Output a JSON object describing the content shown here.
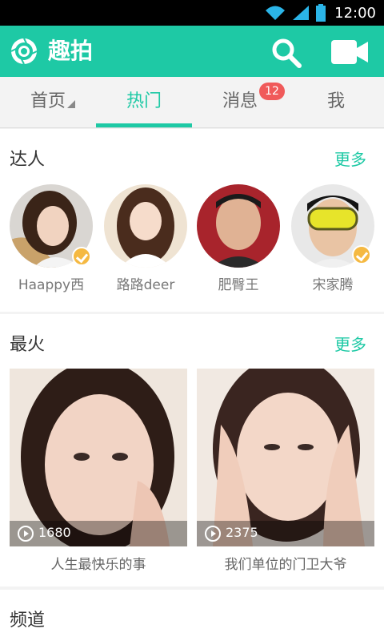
{
  "status": {
    "time": "12:00"
  },
  "header": {
    "title": "趣拍"
  },
  "tabs": [
    {
      "label": "首页"
    },
    {
      "label": "热门",
      "active": true
    },
    {
      "label": "消息",
      "badge": "12"
    },
    {
      "label": "我"
    }
  ],
  "experts": {
    "title": "达人",
    "more": "更多",
    "users": [
      {
        "name": "Haappy西",
        "verified": true
      },
      {
        "name": "路路deer",
        "verified": false
      },
      {
        "name": "肥臀王",
        "verified": false
      },
      {
        "name": "宋家腾",
        "verified": true
      }
    ]
  },
  "hottest": {
    "title": "最火",
    "more": "更多",
    "videos": [
      {
        "plays": "1680",
        "caption": "人生最快乐的事"
      },
      {
        "plays": "2375",
        "caption": "我们单位的门卫大爷"
      }
    ]
  },
  "channels": {
    "title": "频道"
  },
  "colors": {
    "accent": "#1ec9a5",
    "badge": "#f05a5a",
    "verified": "#f5b942"
  }
}
